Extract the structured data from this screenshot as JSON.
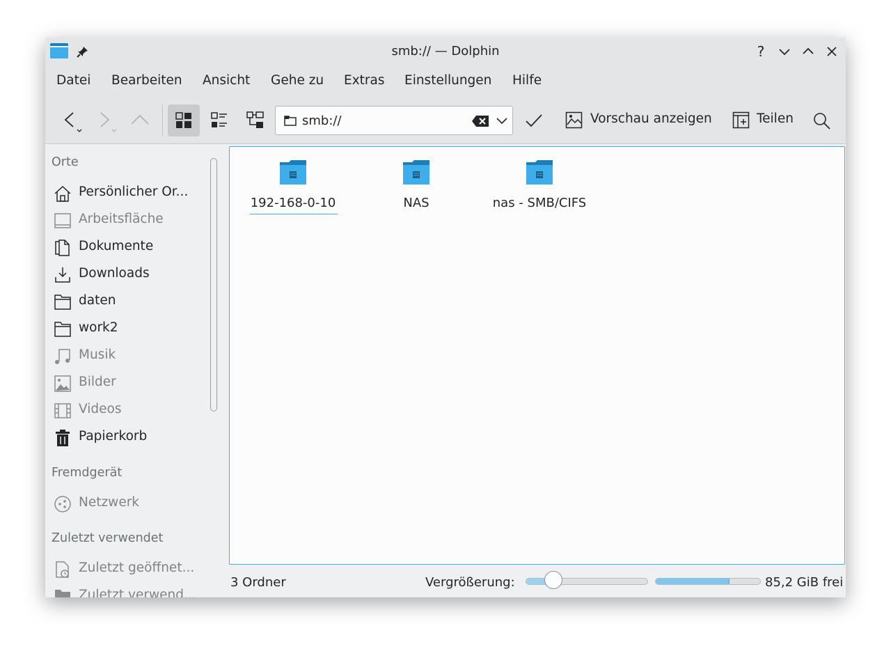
{
  "window": {
    "title": "smb:// — Dolphin"
  },
  "menu": [
    "Datei",
    "Bearbeiten",
    "Ansicht",
    "Gehe zu",
    "Extras",
    "Einstellungen",
    "Hilfe"
  ],
  "toolbar": {
    "address": "smb://",
    "preview_label": "Vorschau anzeigen",
    "share_label": "Teilen"
  },
  "sidebar": {
    "places_header": "Orte",
    "places": [
      {
        "label": "Persönlicher Or...",
        "icon": "home-icon",
        "dimmed": false
      },
      {
        "label": "Arbeitsfläche",
        "icon": "desktop-icon",
        "dimmed": true
      },
      {
        "label": "Dokumente",
        "icon": "documents-icon",
        "dimmed": false
      },
      {
        "label": "Downloads",
        "icon": "download-icon",
        "dimmed": false
      },
      {
        "label": "daten",
        "icon": "folder-icon",
        "dimmed": false
      },
      {
        "label": "work2",
        "icon": "folder-icon",
        "dimmed": false
      },
      {
        "label": "Musik",
        "icon": "music-icon",
        "dimmed": true
      },
      {
        "label": "Bilder",
        "icon": "image-icon",
        "dimmed": true
      },
      {
        "label": "Videos",
        "icon": "video-icon",
        "dimmed": true
      },
      {
        "label": "Papierkorb",
        "icon": "trash-icon",
        "dimmed": false
      }
    ],
    "remote_header": "Fremdgerät",
    "remote": [
      {
        "label": "Netzwerk",
        "icon": "network-icon",
        "dimmed": true
      }
    ],
    "recent_header": "Zuletzt verwendet",
    "recent": [
      {
        "label": "Zuletzt geöffnet...",
        "icon": "recent-files-icon",
        "dimmed": true
      },
      {
        "label": "Zuletzt verwend...",
        "icon": "recent-folders-icon",
        "dimmed": true
      }
    ]
  },
  "files": [
    {
      "name": "192-168-0-10",
      "icon": "network-folder-icon",
      "selected": true
    },
    {
      "name": "NAS",
      "icon": "network-folder-icon",
      "selected": false
    },
    {
      "name": "nas - SMB/CIFS",
      "icon": "network-folder-icon",
      "selected": false
    }
  ],
  "status": {
    "count": "3 Ordner",
    "zoom_label": "Vergrößerung:",
    "zoom_level": 0.2,
    "free_space": "85,2 GiB frei",
    "used_fraction": 0.7
  },
  "colors": {
    "accent": "#3daee9",
    "folder": "#3daee9",
    "folder_dark": "#1d7fb8"
  }
}
